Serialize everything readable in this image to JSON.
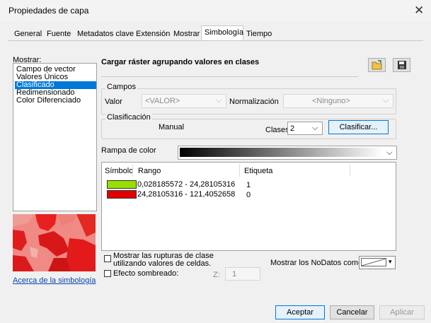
{
  "window": {
    "title": "Propiedades de capa"
  },
  "tabs": [
    {
      "label": "General"
    },
    {
      "label": "Fuente"
    },
    {
      "label": "Metadatos clave"
    },
    {
      "label": "Extensión"
    },
    {
      "label": "Mostrar"
    },
    {
      "label": "Simbología",
      "active": true
    },
    {
      "label": "Tiempo"
    }
  ],
  "show": {
    "label": "Mostrar:",
    "items": [
      "Campo de vector",
      "Valores Únicos",
      "Clasificado",
      "Redimensionado",
      "Color Diferenciado"
    ],
    "selected": "Clasificado"
  },
  "header": {
    "title": "Cargar ráster agrupando valores en clases"
  },
  "fields": {
    "group_label": "Campos",
    "value_label": "Valor",
    "value_select": "<VALOR>",
    "normalization_label": "Normalización",
    "normalization_select": "<Ninguno>"
  },
  "classification": {
    "group_label": "Clasificación",
    "method": "Manual",
    "classes_label": "Clases",
    "classes_value": "2",
    "classify_button": "Clasificar..."
  },
  "color_ramp": {
    "label": "Rampa de color"
  },
  "table": {
    "headers": [
      "Símbolo",
      "Rango",
      "Etiqueta"
    ],
    "rows": [
      {
        "color": "#99e000",
        "range": "0,028185572 - 24,28105316",
        "label": "1"
      },
      {
        "color": "#e00000",
        "range": "24,28105316 - 121,4052658",
        "label": "0"
      }
    ]
  },
  "options": {
    "show_breaks": "Mostrar las rupturas de clase utilizando valores de celdas.",
    "hillshade": "Efecto sombreado:",
    "z_label": "Z:",
    "z_value": "1",
    "nodata_label": "Mostrar los NoDatos como"
  },
  "about_link": "Acerca de la simbología",
  "buttons": {
    "ok": "Aceptar",
    "cancel": "Cancelar",
    "apply": "Aplicar"
  }
}
